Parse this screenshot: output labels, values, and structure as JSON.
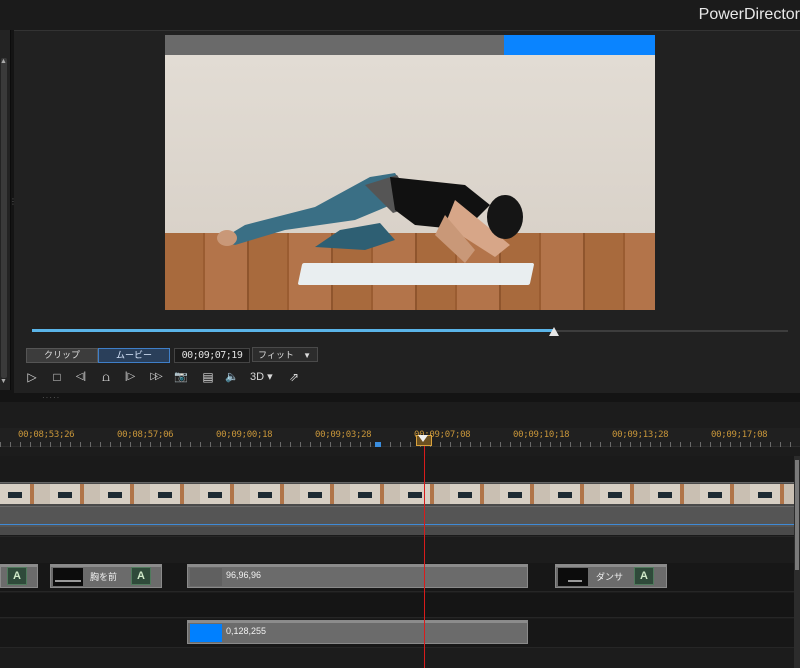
{
  "app": {
    "title": "PowerDirector"
  },
  "left_panel": {
    "scroll_up": "▲",
    "scroll_down": "▼",
    "grip": "⋮"
  },
  "preview": {
    "progress_percent": 69,
    "mode_clip_label": "クリップ",
    "mode_movie_label": "ムービー",
    "timecode": "00;09;07;19",
    "fit_label": "フィット",
    "fit_caret": "▼",
    "transport": {
      "play": "▷",
      "stop": "□",
      "prev_frame": "◁|",
      "mark": "⩍",
      "next_frame": "|▷",
      "fast_forward": "▷▷",
      "snapshot": "📷",
      "subtitle": "▤",
      "volume": "🔈",
      "three_d": "3D ▾",
      "undock": "⇗"
    },
    "bottom_grip": "·····"
  },
  "timeline": {
    "ruler_labels": [
      "00;08;53;26",
      "00;08;57;06",
      "00;09;00;18",
      "00;09;03;28",
      "00;09;07;08",
      "00;09;10;18",
      "00;09;13;28",
      "00;09;17;08"
    ],
    "title_clips": [
      {
        "label": "",
        "a_icon": "A"
      },
      {
        "label": "胸を前",
        "a_icon": "A"
      },
      {
        "label": "96,96,96",
        "color": "#606060"
      },
      {
        "label": "ダンサ",
        "a_icon": "A"
      }
    ],
    "color_clip": {
      "label": "0,128,255",
      "color": "#0080ff"
    }
  },
  "colors": {
    "accent_blue": "#0a84ff",
    "playhead_red": "#d81c1c",
    "ruler_orange": "#c8963a"
  }
}
